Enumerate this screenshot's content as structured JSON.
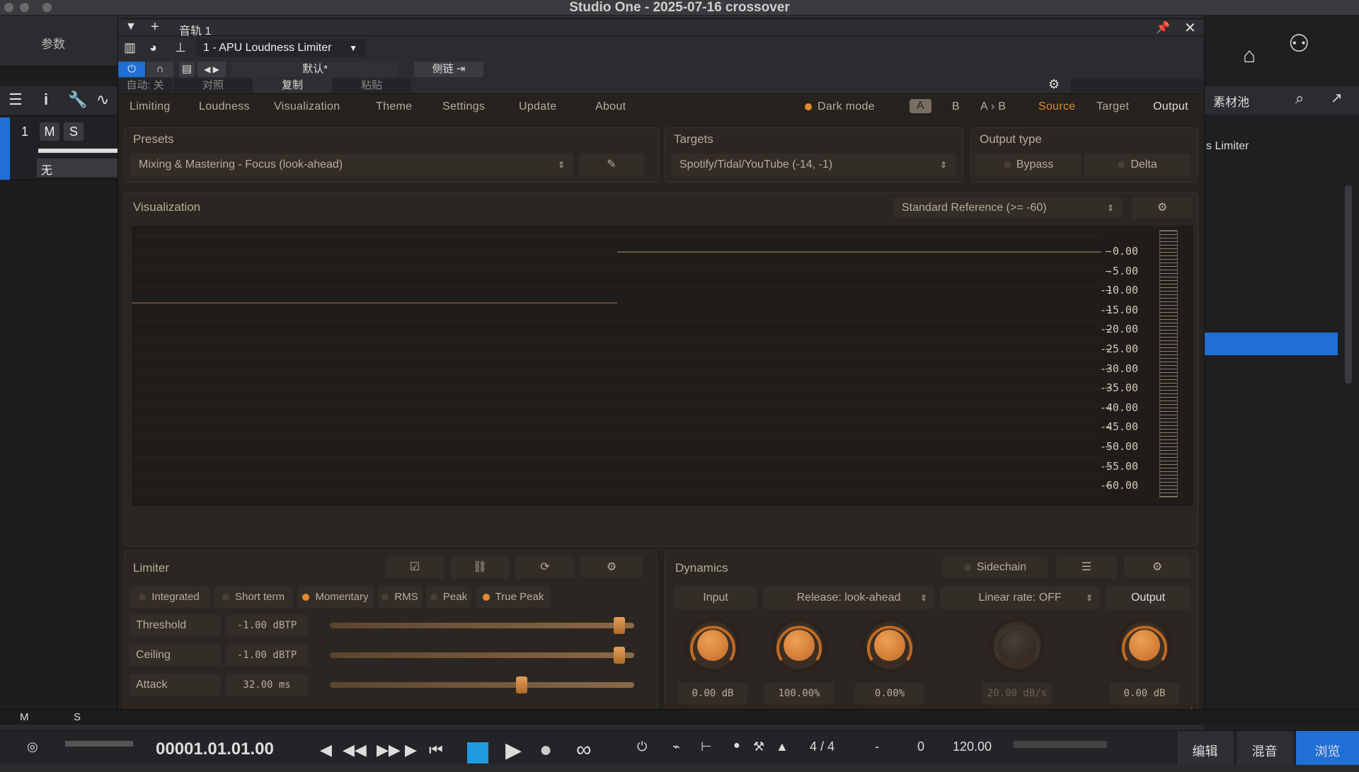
{
  "app_title": "Studio One - 2025-07-16 crossover",
  "left_panel": {
    "header": "参数",
    "track": {
      "number": "1",
      "mute": "M",
      "solo": "S",
      "input": "无"
    },
    "bottom_m": "M",
    "bottom_s": "S"
  },
  "right_panel": {
    "header": "素材池",
    "item": "s Limiter"
  },
  "plugin": {
    "track_name": "音轨 1",
    "instance": "1 - APU Loudness Limiter",
    "preset_name": "默认*",
    "sidechain": "侧链",
    "auto_off": "自动: 关",
    "compare": "对照",
    "copy": "复制",
    "paste": "粘贴"
  },
  "tabs": [
    "Limiting",
    "Loudness",
    "Visualization",
    "Theme",
    "Settings",
    "Update",
    "About"
  ],
  "dark_mode": "Dark mode",
  "ab": {
    "a": "A",
    "b": "B",
    "a_to_b": "A › B"
  },
  "io": {
    "source": "Source",
    "target": "Target",
    "output": "Output"
  },
  "presets": {
    "label": "Presets",
    "value": "Mixing & Mastering - Focus (look-ahead)"
  },
  "targets": {
    "label": "Targets",
    "value": "Spotify/Tidal/YouTube (-14, -1)"
  },
  "output_type": {
    "label": "Output type",
    "bypass": "Bypass",
    "delta": "Delta"
  },
  "visualization": {
    "label": "Visualization",
    "reference": "Standard Reference (>= -60)",
    "scale": [
      "0.00",
      "-5.00",
      "-10.00",
      "-15.00",
      "-20.00",
      "-25.00",
      "-30.00",
      "-35.00",
      "-40.00",
      "-45.00",
      "-50.00",
      "-55.00",
      "-60.00"
    ]
  },
  "limiter": {
    "label": "Limiter",
    "modes": [
      {
        "label": "Integrated",
        "on": false
      },
      {
        "label": "Short term",
        "on": false
      },
      {
        "label": "Momentary",
        "on": true
      },
      {
        "label": "RMS",
        "on": false
      },
      {
        "label": "Peak",
        "on": false
      },
      {
        "label": "True Peak",
        "on": true
      }
    ],
    "rows": [
      {
        "name": "Threshold",
        "value": "-1.00 dBTP",
        "level": 0.95
      },
      {
        "name": "Ceiling",
        "value": "-1.00 dBTP",
        "level": 0.95
      },
      {
        "name": "Attack",
        "value": "32.00 ms",
        "level": 0.63
      }
    ]
  },
  "dynamics": {
    "label": "Dynamics",
    "sidechain": "Sidechain",
    "input": "Input",
    "release": "Release: look-ahead",
    "linear_rate": "Linear rate: OFF",
    "output": "Output",
    "values": [
      "0.00 dB",
      "100.00%",
      "0.00%",
      "20.00 dB/s",
      "0.00 dB"
    ]
  },
  "transport": {
    "time": "00001.01.01.00",
    "signature": "4 / 4",
    "dash": "-",
    "transpose": "0",
    "tempo": "120.00",
    "nav": [
      "编辑",
      "混音",
      "浏览"
    ]
  },
  "colors": {
    "accent": "#e08a2c",
    "blue": "#1f6fd6"
  }
}
